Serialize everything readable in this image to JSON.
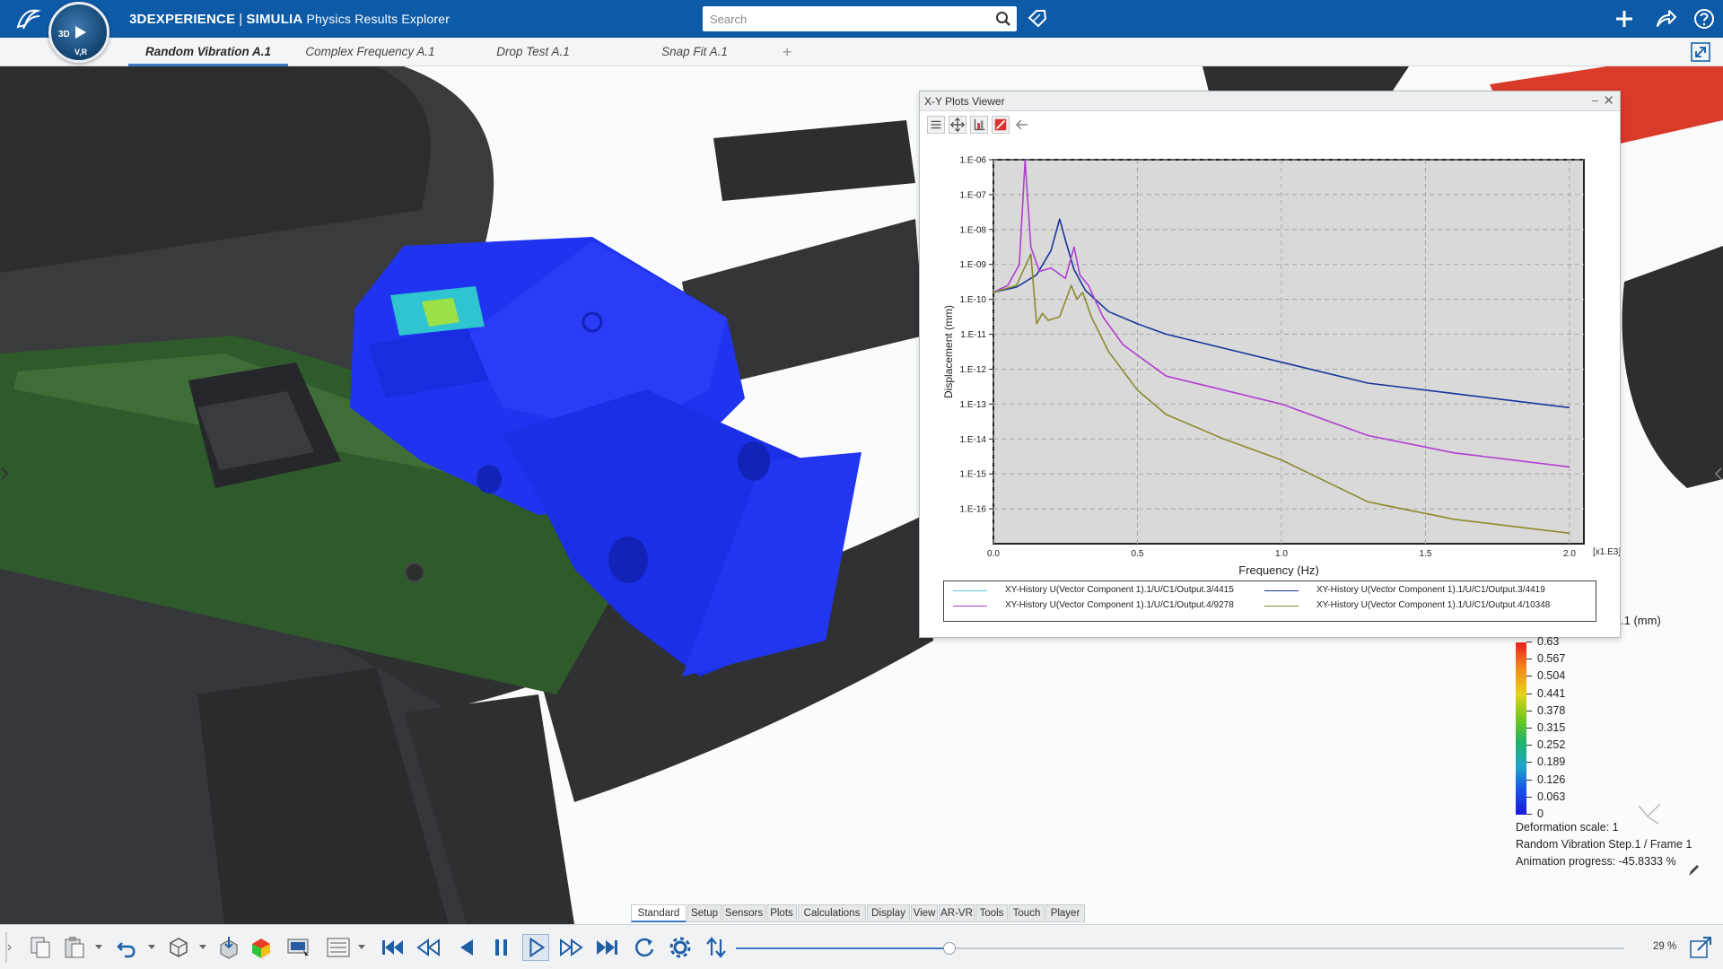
{
  "app": {
    "brand": "3DEXPERIENCE",
    "separator": "|",
    "product": "SIMULIA",
    "app_name": "Physics Results Explorer",
    "compass_top": "3D",
    "compass_bottom": "V,R"
  },
  "search": {
    "placeholder": "Search",
    "value": ""
  },
  "tabs": [
    {
      "label": "Random Vibration A.1",
      "active": true
    },
    {
      "label": "Complex Frequency A.1",
      "active": false
    },
    {
      "label": "Drop Test A.1",
      "active": false
    },
    {
      "label": "Snap Fit A.1",
      "active": false
    }
  ],
  "tab_add": "+",
  "xy_viewer": {
    "title": "X-Y Plots Viewer",
    "minimize": "–",
    "close": "✕"
  },
  "chart_data": {
    "type": "line",
    "xlabel": "Frequency (Hz)",
    "ylabel": "Displacement (mm)",
    "x_multiplier": "[x1.E3]",
    "xlim": [
      0,
      2.05
    ],
    "x_ticks": [
      "0.0",
      "0.5",
      "1.0",
      "1.5",
      "2.0"
    ],
    "y_log": true,
    "ylim_exp": [
      -17,
      -6
    ],
    "y_ticks": [
      "1.E-06",
      "1.E-07",
      "1.E-08",
      "1.E-09",
      "1.E-10",
      "1.E-11",
      "1.E-12",
      "1.E-13",
      "1.E-14",
      "1.E-15",
      "1.E-16"
    ],
    "grid": true,
    "legend_position": "bottom",
    "series": [
      {
        "name": "XY-History U(Vector Component 1).1/U/C1/Output.3/4415",
        "color": "#5ec8d6",
        "x": [],
        "log10_y": []
      },
      {
        "name": "XY-History U(Vector Component 1).1/U/C1/Output.3/4419",
        "color": "#16359a",
        "x": [
          0.0,
          0.08,
          0.15,
          0.2,
          0.23,
          0.25,
          0.28,
          0.32,
          0.4,
          0.5,
          0.6,
          0.8,
          1.0,
          1.3,
          1.6,
          2.0
        ],
        "log10_y": [
          -9.8,
          -9.65,
          -9.3,
          -8.6,
          -7.7,
          -8.3,
          -9.15,
          -9.75,
          -10.35,
          -10.7,
          -11.0,
          -11.4,
          -11.8,
          -12.4,
          -12.7,
          -13.1
        ]
      },
      {
        "name": "XY-History U(Vector Component 1).1/U/C1/Output.4/9278",
        "color": "#b03ed0",
        "x": [
          0.0,
          0.05,
          0.09,
          0.11,
          0.13,
          0.16,
          0.2,
          0.25,
          0.28,
          0.3,
          0.33,
          0.38,
          0.45,
          0.6,
          0.8,
          1.0,
          1.3,
          1.6,
          2.0
        ],
        "log10_y": [
          -9.8,
          -9.6,
          -9.0,
          -6.0,
          -8.5,
          -9.2,
          -9.1,
          -9.4,
          -8.5,
          -9.3,
          -9.6,
          -10.5,
          -11.3,
          -12.2,
          -12.6,
          -13.0,
          -13.9,
          -14.4,
          -14.8
        ]
      },
      {
        "name": "XY-History U(Vector Component 1).1/U/C1/Output.4/10348",
        "color": "#8a8a2a",
        "x": [
          0.0,
          0.08,
          0.13,
          0.15,
          0.17,
          0.19,
          0.23,
          0.27,
          0.29,
          0.31,
          0.34,
          0.4,
          0.5,
          0.6,
          0.8,
          1.0,
          1.3,
          1.6,
          2.0
        ],
        "log10_y": [
          -9.8,
          -9.6,
          -8.7,
          -10.7,
          -10.4,
          -10.6,
          -10.5,
          -9.6,
          -10.0,
          -9.8,
          -10.5,
          -11.5,
          -12.6,
          -13.3,
          -14.0,
          -14.6,
          -15.8,
          -16.3,
          -16.7
        ]
      }
    ]
  },
  "legend_panel": {
    "unit_label": ".1 (mm)",
    "colorbar_ticks": [
      "0.63",
      "0.567",
      "0.504",
      "0.441",
      "0.378",
      "0.315",
      "0.252",
      "0.189",
      "0.126",
      "0.063",
      "0"
    ],
    "colors": {
      "max": "#e8201e",
      "min": "#1a1ad8"
    },
    "deformation_scale": "Deformation scale: 1",
    "step_frame": "Random Vibration Step.1 / Frame 1",
    "animation_progress": "Animation progress: -45.8333 %"
  },
  "bottom_tabs": [
    {
      "label": "Standard",
      "active": true
    },
    {
      "label": "Setup",
      "active": false
    },
    {
      "label": "Sensors",
      "active": false
    },
    {
      "label": "Plots",
      "active": false
    },
    {
      "label": "Calculations",
      "active": false
    },
    {
      "label": "Display",
      "active": false
    },
    {
      "label": "View",
      "active": false
    },
    {
      "label": "AR-VR",
      "active": false
    },
    {
      "label": "Tools",
      "active": false
    },
    {
      "label": "Touch",
      "active": false
    },
    {
      "label": "Player",
      "active": false
    }
  ],
  "toolbar": {
    "icons": [
      "copy-icon",
      "paste-icon",
      "undo-icon",
      "shape-icon",
      "save-icon",
      "contour-icon",
      "display-icon",
      "list-icon",
      "jump-to-start-icon",
      "rewind-icon",
      "step-back-icon",
      "pause-icon",
      "play-icon",
      "fast-forward-icon",
      "jump-to-end-icon",
      "loop-icon",
      "player-settings-icon",
      "player-options-icon"
    ],
    "playback_position": 0.24,
    "zoom_level": "29 %"
  },
  "colors": {
    "accent": "#0d5aa7",
    "selection": "#3a7bc2",
    "model_blue": "#1f33f0",
    "pcb_green": "#2e5a2a"
  }
}
